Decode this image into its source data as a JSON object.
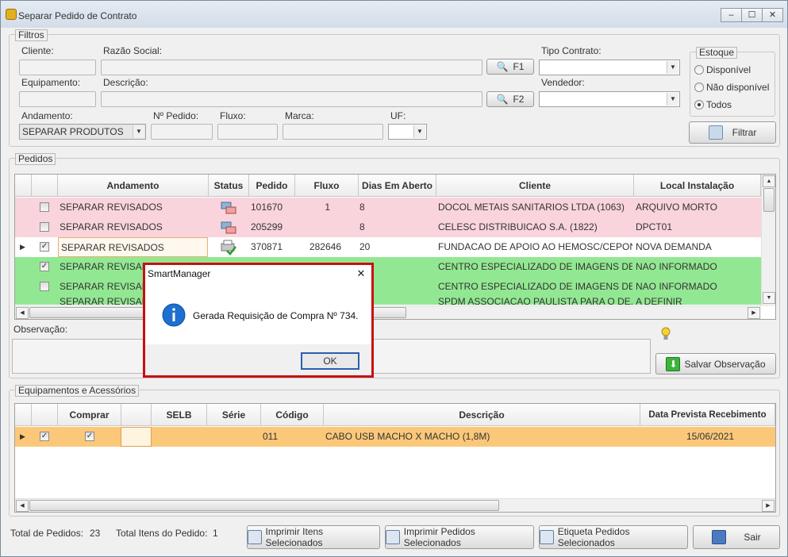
{
  "window": {
    "title": "Separar Pedido de Contrato",
    "minimize": "‒",
    "maximize": "☐",
    "close": "✕"
  },
  "filters": {
    "group_label": "Filtros",
    "cliente_label": "Cliente:",
    "razao_label": "Razão Social:",
    "f1_label": "F1",
    "tipo_contrato_label": "Tipo Contrato:",
    "equipamento_label": "Equipamento:",
    "descricao_label": "Descrição:",
    "f2_label": "F2",
    "vendedor_label": "Vendedor:",
    "andamento_label": "Andamento:",
    "andamento_value": "SEPARAR PRODUTOS",
    "npedido_label": "Nº Pedido:",
    "fluxo_label": "Fluxo:",
    "marca_label": "Marca:",
    "uf_label": "UF:",
    "estoque_label": "Estoque",
    "estoque_options": [
      "Disponível",
      "Não disponível",
      "Todos"
    ],
    "estoque_selected": "Todos",
    "filtrar_label": "Filtrar"
  },
  "pedidos": {
    "group_label": "Pedidos",
    "columns": [
      "Andamento",
      "Status",
      "Pedido",
      "Fluxo",
      "Dias Em Aberto",
      "Cliente",
      "Local Instalação"
    ],
    "rows": [
      {
        "andamento": "SEPARAR REVISADOS",
        "pedido": "101670",
        "fluxo": "1",
        "dias": "8",
        "cliente": "DOCOL METAIS SANITARIOS LTDA (1063)",
        "local": "ARQUIVO MORTO",
        "checked": false,
        "color": "#f9d4dc"
      },
      {
        "andamento": "SEPARAR REVISADOS",
        "pedido": "205299",
        "fluxo": "",
        "dias": "8",
        "cliente": "CELESC DISTRIBUICAO S.A. (1822)",
        "local": "DPCT01",
        "checked": false,
        "color": "#f9d4dc"
      },
      {
        "andamento": "SEPARAR REVISADOS",
        "pedido": "370871",
        "fluxo": "282646",
        "dias": "20",
        "cliente": "FUNDACAO DE APOIO AO HEMOSC/CEPON...",
        "local": "NOVA DEMANDA",
        "checked": true,
        "color": "#ffffff"
      },
      {
        "andamento": "SEPARAR REVISADOS",
        "pedido": "",
        "fluxo": "",
        "dias": "",
        "cliente": "CENTRO ESPECIALIZADO DE IMAGENS DE...",
        "local": "NAO INFORMADO",
        "checked": true,
        "color": "#92e892"
      },
      {
        "andamento": "SEPARAR REVISADOS",
        "pedido": "",
        "fluxo": "",
        "dias": "",
        "cliente": "CENTRO ESPECIALIZADO DE IMAGENS DE...",
        "local": "NAO INFORMADO",
        "checked": false,
        "color": "#92e892"
      },
      {
        "andamento": "SEPARAR REVISADOS",
        "pedido": "",
        "fluxo": "",
        "dias": "",
        "cliente": "SPDM ASSOCIACAO PAULISTA PARA O DE...",
        "local": "A DEFINIR",
        "checked": false,
        "color": "#92e892"
      }
    ]
  },
  "observacao": {
    "label": "Observação:",
    "save_label": "Salvar Observação"
  },
  "equipamentos": {
    "group_label": "Equipamentos e Acessórios",
    "columns": [
      "Comprar",
      "SELB",
      "Série",
      "Código",
      "Descrição",
      "Data Prevista Recebimento"
    ],
    "rows": [
      {
        "codigo": "011",
        "descricao": "CABO USB MACHO X MACHO (1,8M)",
        "data": "15/06/2021",
        "checked": true,
        "comprar": true
      }
    ]
  },
  "footer": {
    "total_pedidos_label": "Total de Pedidos:",
    "total_pedidos_value": "23",
    "total_itens_label": "Total Itens do Pedido:",
    "total_itens_value": "1",
    "imprimir_itens": "Imprimir Itens Selecionados",
    "imprimir_pedidos": "Imprimir Pedidos Selecionados",
    "etiqueta": "Etiqueta Pedidos Selecionados",
    "sair": "Sair"
  },
  "dialog": {
    "title": "SmartManager",
    "message": "Gerada Requisição de Compra Nº 734.",
    "ok": "OK",
    "close": "✕"
  },
  "colors": {
    "pink_row": "#f9d4dc",
    "green_row": "#92e892",
    "selected_row": "#fbc87a",
    "dialog_border": "#c81010"
  }
}
